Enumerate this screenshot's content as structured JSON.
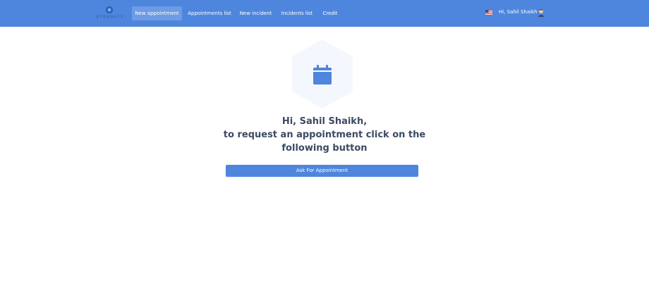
{
  "app": {
    "logo_text": "ETERNITY"
  },
  "nav": {
    "items": [
      {
        "label": "New appointment",
        "active": true
      },
      {
        "label": "Appointments list"
      },
      {
        "label": "New incident"
      },
      {
        "label": "Incidents list"
      },
      {
        "label": "Credit"
      }
    ]
  },
  "user": {
    "greeting": "Hi, Sahil Shaikh"
  },
  "main": {
    "line1": "Hi, Sahil Shaikh,",
    "line2": "to request an appointment click on the",
    "line3": "following button",
    "button_label": "Ask For Appointment"
  },
  "icons": {
    "logo": "logo-icon",
    "flag": "us-flag-icon",
    "avatar": "user-avatar-icon",
    "hero": "calendar-icon"
  },
  "colors": {
    "primary": "#4f86dd",
    "heading": "#3b4a63",
    "hexagon": "#f4f7fd"
  }
}
